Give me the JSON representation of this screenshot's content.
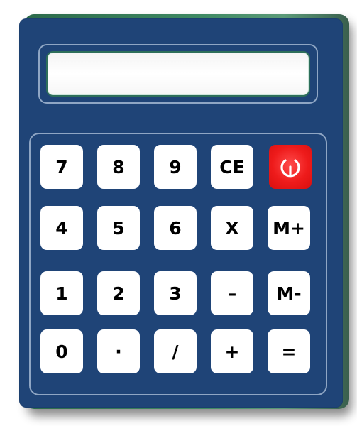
{
  "display": {
    "value": ""
  },
  "keys": {
    "k7": "7",
    "k8": "8",
    "k9": "9",
    "ce": "CE",
    "k4": "4",
    "k5": "5",
    "k6": "6",
    "multiply": "X",
    "mplus": "M+",
    "k1": "1",
    "k2": "2",
    "k3": "3",
    "minus": "–",
    "mminus": "M-",
    "k0": "0",
    "dot": "·",
    "divide": "/",
    "plus": "+",
    "equals": "="
  },
  "power_icon": "power-icon",
  "colors": {
    "body": "#1f4477",
    "frame_line": "#8fa6c4",
    "key": "#ffffff",
    "power": "#ee1b1b"
  }
}
